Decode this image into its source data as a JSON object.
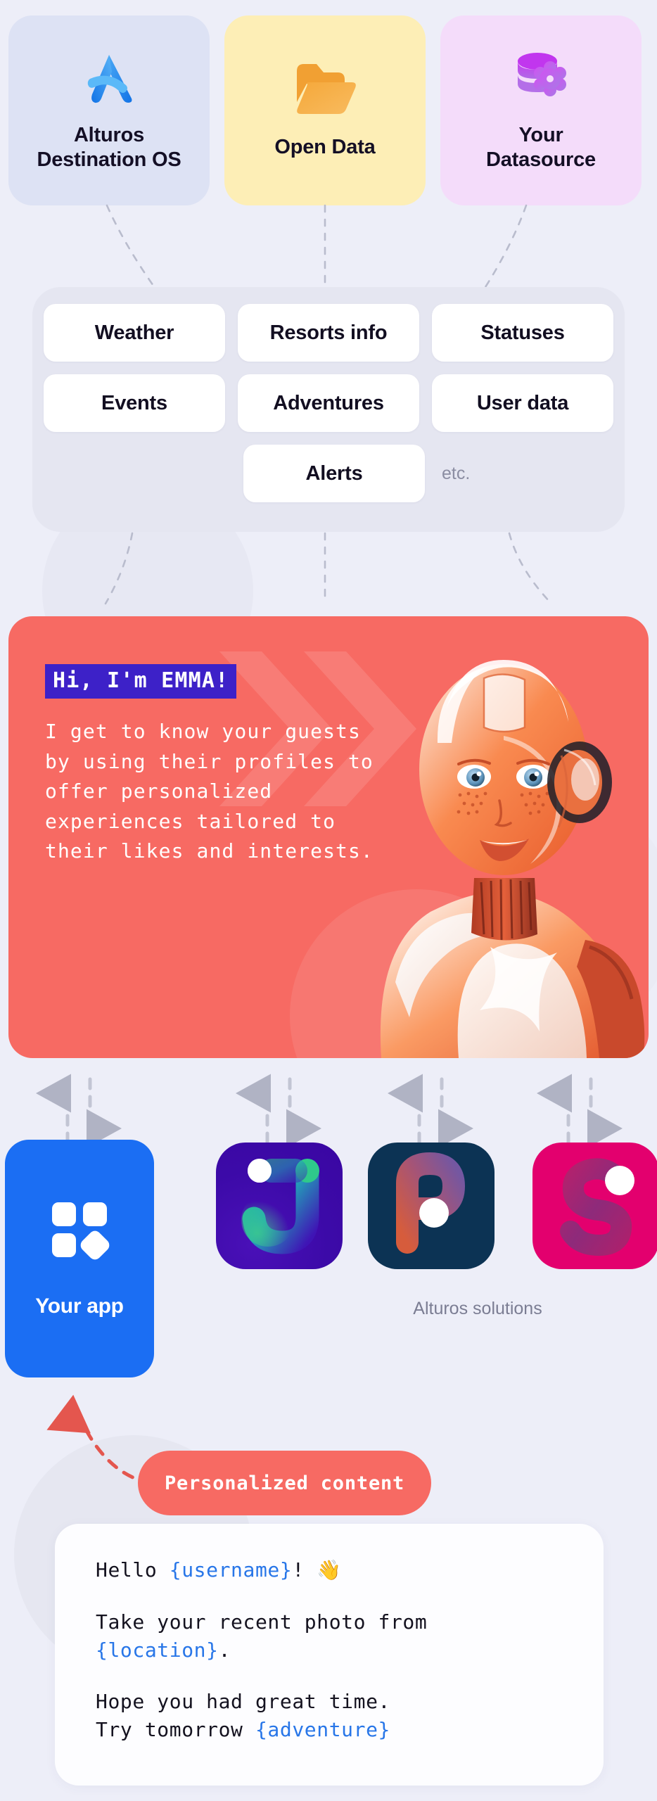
{
  "colors": {
    "page_bg": "#edeef8",
    "alturos_card_bg": "#dde2f4",
    "opendata_card_bg": "#fdeeb6",
    "datasource_card_bg": "#f4dcfa",
    "chips_panel_bg": "#e5e6f1",
    "chip_bg": "#ffffff",
    "emma_bg": "#f76a63",
    "emma_badge_bg": "#3d21c8",
    "your_app_bg": "#1b6ef3",
    "app_j_bg": "#3c0aa8",
    "app_p_bg": "#0c3354",
    "app_s_bg": "#e3006e",
    "token_blue": "#2876e8",
    "muted_text": "#7b7d93"
  },
  "sources": [
    {
      "id": "alturos",
      "icon": "alturos-logo-icon",
      "title": "Alturos\nDestination OS"
    },
    {
      "id": "opendata",
      "icon": "open-folder-icon",
      "title": "Open Data"
    },
    {
      "id": "datasource",
      "icon": "database-gear-icon",
      "title": "Your\nDatasource"
    }
  ],
  "chips": {
    "row1": [
      "Weather",
      "Resorts info",
      "Statuses"
    ],
    "row2": [
      "Events",
      "Adventures",
      "User data"
    ],
    "row3": [
      "Alerts"
    ],
    "etc": "etc."
  },
  "emma": {
    "badge": "Hi, I'm EMMA!",
    "body": "I get to know your guests by using their profiles to offer personalized experiences tailored to their likes and interests.",
    "illustration": "robot-assistant-image"
  },
  "apps": {
    "your_app": {
      "label": "Your app",
      "icon": "app-grid-icon"
    },
    "solutions_label": "Alturos solutions",
    "tiles": [
      {
        "id": "j",
        "letter": "J",
        "icon": "alturos-j-app-icon"
      },
      {
        "id": "p",
        "letter": "P",
        "icon": "alturos-p-app-icon"
      },
      {
        "id": "s",
        "letter": "S",
        "icon": "alturos-s-app-icon"
      }
    ]
  },
  "personalized": {
    "pill_label": "Personalized content",
    "message_lines": [
      {
        "parts": [
          {
            "t": "Hello ",
            "token": false
          },
          {
            "t": "{username}",
            "token": true
          },
          {
            "t": "! 👋",
            "token": false
          }
        ]
      },
      {
        "parts": [
          {
            "t": "Take your recent photo from ",
            "token": false
          },
          {
            "t": "{location}",
            "token": true
          },
          {
            "t": ".",
            "token": false
          }
        ]
      },
      {
        "parts": [
          {
            "t": "Hope you had great time.\nTry tomorrow ",
            "token": false
          },
          {
            "t": "{adventure}",
            "token": true
          }
        ]
      }
    ]
  }
}
